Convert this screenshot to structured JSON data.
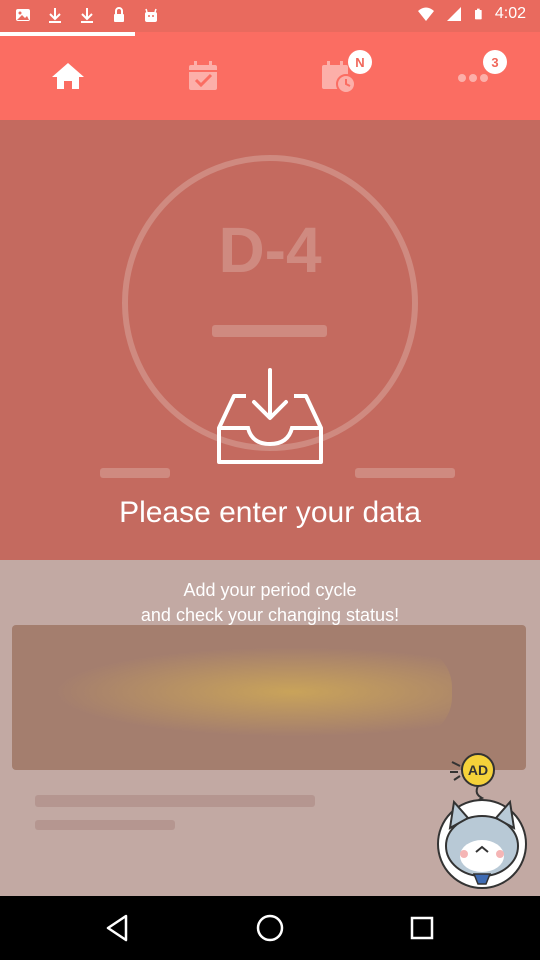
{
  "status_bar": {
    "time": "4:02",
    "icons": [
      "image-icon",
      "download-icon",
      "download-icon",
      "lock-icon",
      "android-icon",
      "wifi-icon",
      "signal-icon",
      "battery-icon"
    ]
  },
  "tabs": [
    {
      "name": "home-icon",
      "active": true,
      "badge": ""
    },
    {
      "name": "calendar-check-icon",
      "active": false,
      "badge": ""
    },
    {
      "name": "calendar-clock-icon",
      "active": false,
      "badge": "N"
    },
    {
      "name": "more-dots-icon",
      "active": false,
      "badge": "3"
    }
  ],
  "overlay": {
    "icon": "inbox-download-icon",
    "headline": "Please enter your data",
    "subtext_line1": "Add your period cycle",
    "subtext_line2": "and check your changing status!"
  },
  "background": {
    "dday_text": "D-4"
  },
  "ad": {
    "label": "AD",
    "icon": "cat-mascot-icon"
  },
  "nav": [
    "back-icon",
    "home-circle-icon",
    "recents-icon"
  ],
  "colors": {
    "accent": "#fb6d62",
    "status_bar": "#e96a5e",
    "overlay_bg": "#c46a5f",
    "text": "#ffffff"
  }
}
